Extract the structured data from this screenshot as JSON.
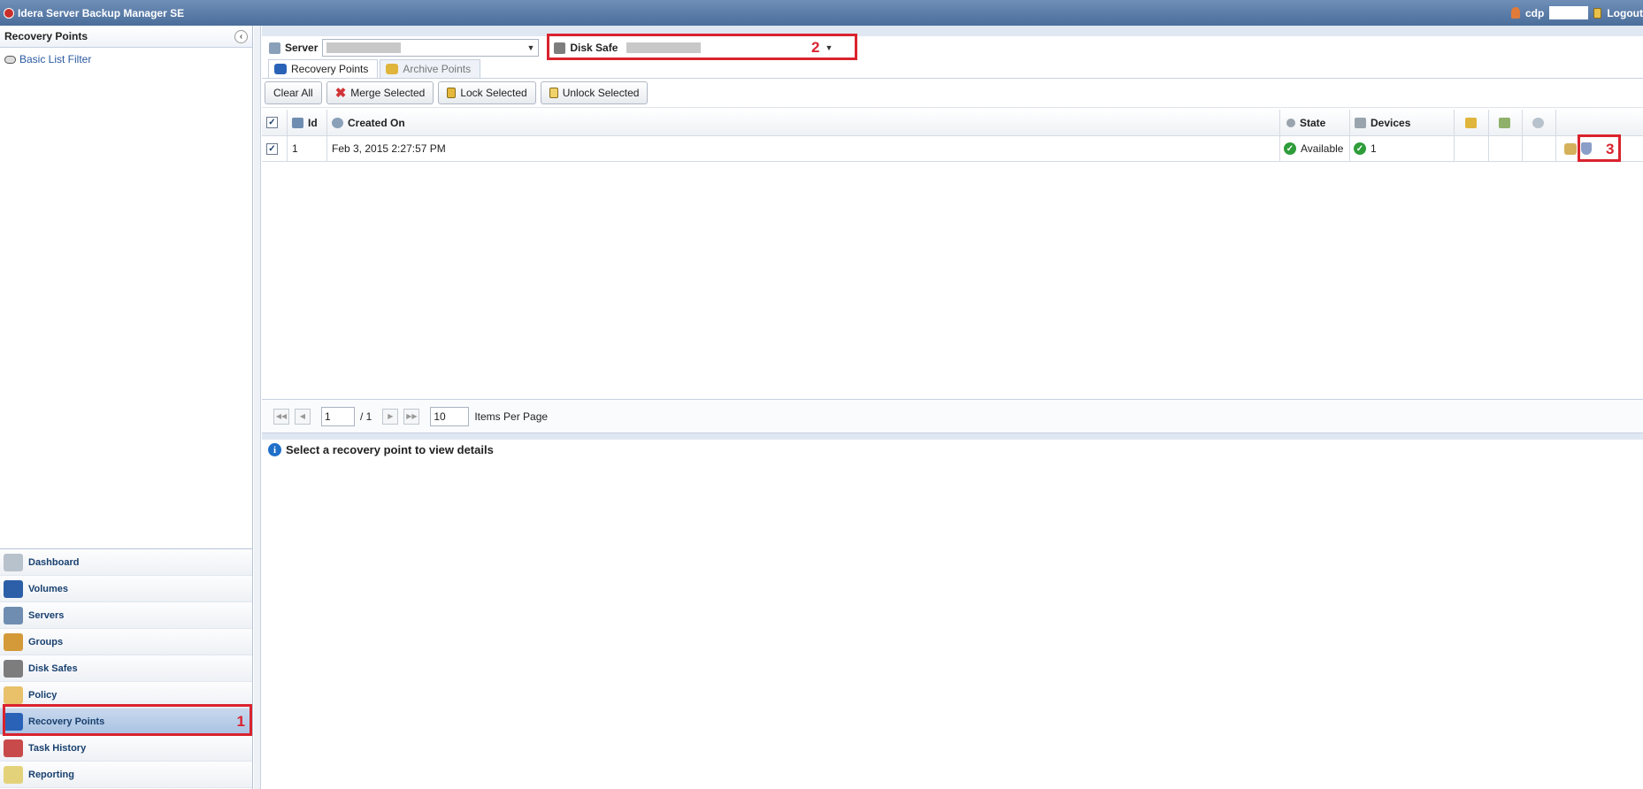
{
  "app": {
    "title": "Idera Server Backup Manager SE",
    "user": "cdp",
    "logout": "Logout"
  },
  "left_panel": {
    "title": "Recovery Points",
    "filter": "Basic List Filter",
    "nav": [
      {
        "label": "Dashboard"
      },
      {
        "label": "Volumes"
      },
      {
        "label": "Servers"
      },
      {
        "label": "Groups"
      },
      {
        "label": "Disk Safes"
      },
      {
        "label": "Policy"
      },
      {
        "label": "Recovery Points",
        "callout": "1"
      },
      {
        "label": "Task History"
      },
      {
        "label": "Reporting"
      }
    ]
  },
  "selectors": {
    "server_label": "Server",
    "disk_safe_label": "Disk Safe",
    "disk_safe_callout": "2"
  },
  "tabs": [
    {
      "label": "Recovery Points"
    },
    {
      "label": "Archive Points"
    }
  ],
  "toolbar": {
    "clear_all": "Clear All",
    "merge": "Merge Selected",
    "lock": "Lock Selected",
    "unlock": "Unlock Selected"
  },
  "grid": {
    "headers": {
      "id": "Id",
      "created": "Created On",
      "state": "State",
      "devices": "Devices"
    },
    "rows": [
      {
        "id": "1",
        "created": "Feb 3, 2015 2:27:57 PM",
        "state": "Available",
        "devices": "1",
        "callout": "3"
      }
    ]
  },
  "pager": {
    "page": "1",
    "of": "/ 1",
    "per_page": "10",
    "per_page_label": "Items Per Page"
  },
  "details": {
    "message": "Select a recovery point to view details"
  },
  "colors": {
    "accent_red": "#d9232e",
    "header_blue": "#4a6d9a",
    "ok_green": "#2e9d3a"
  }
}
